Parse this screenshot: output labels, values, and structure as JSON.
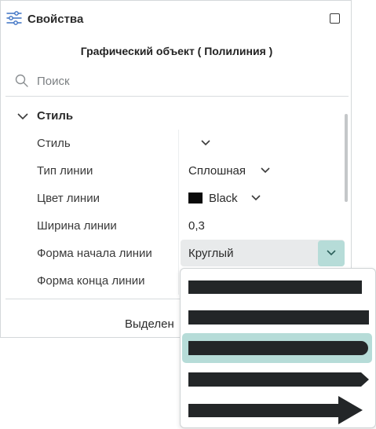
{
  "panel": {
    "title": "Свойства",
    "icon": "sliders-icon",
    "maximize_icon": "square-icon"
  },
  "object_title": "Графический объект ( Полилиния )",
  "search": {
    "placeholder": "Поиск",
    "value": ""
  },
  "section": {
    "title": "Стиль",
    "expanded": true
  },
  "properties": [
    {
      "label": "Стиль",
      "value": ""
    },
    {
      "label": "Тип линии",
      "value": "Сплошная"
    },
    {
      "label": "Цвет линии",
      "value": "Black",
      "swatch_color": "#0a0a0a"
    },
    {
      "label": "Ширина линии",
      "value": "0,3"
    },
    {
      "label": "Форма начала линии",
      "value": "Круглый"
    },
    {
      "label": "Форма конца линии",
      "value": ""
    }
  ],
  "footer": {
    "text": "Выделен"
  },
  "dropdown": {
    "options": [
      {
        "name": "flat",
        "selected": false
      },
      {
        "name": "square",
        "selected": false
      },
      {
        "name": "round",
        "selected": true
      },
      {
        "name": "arrow-small",
        "selected": false
      },
      {
        "name": "arrow-large",
        "selected": false
      }
    ]
  },
  "colors": {
    "accent": "#b6dcd8",
    "line": "#232628"
  }
}
